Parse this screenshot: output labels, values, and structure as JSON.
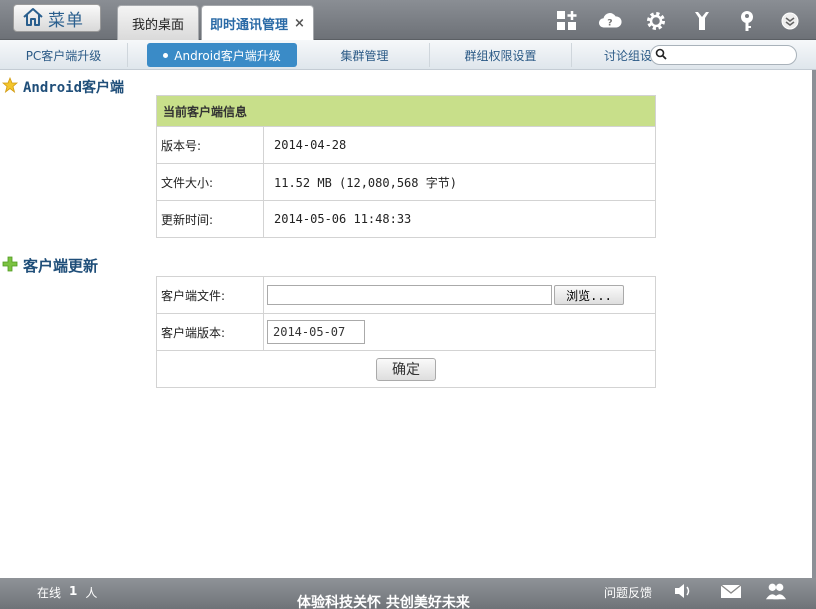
{
  "menu": {
    "label": "菜单",
    "icon": "home-icon"
  },
  "tabs": [
    {
      "label": "我的桌面"
    },
    {
      "label": "即时通讯管理",
      "close": "×"
    }
  ],
  "top_icons": [
    "add-window-icon",
    "help-cloud-icon",
    "gear-icon",
    "tools-icon",
    "key-icon",
    "chevron-down-icon"
  ],
  "subnav": {
    "items": [
      "PC客户端升级",
      "Android客户端升级",
      "集群管理",
      "群组权限设置",
      "讨论组设"
    ],
    "active_index": 1,
    "search_placeholder": ""
  },
  "android_section": {
    "title": "Android客户端",
    "table_header": "当前客户端信息",
    "rows": [
      {
        "label": "版本号:",
        "value": "2014-04-28"
      },
      {
        "label": "文件大小:",
        "value": "11.52 MB (12,080,568 字节)"
      },
      {
        "label": "更新时间:",
        "value": "2014-05-06 11:48:33"
      }
    ]
  },
  "update_section": {
    "title": "客户端更新",
    "file_label": "客户端文件:",
    "file_value": "",
    "browse_label": "浏览...",
    "version_label": "客户端版本:",
    "version_value": "2014-05-07",
    "submit_label": "确定"
  },
  "footer": {
    "online_prefix": "在线",
    "online_count": "1",
    "online_suffix": "人",
    "slogan": "体验科技关怀 共创美好未来",
    "feedback": "问题反馈",
    "icons": [
      "speaker-icon",
      "mail-icon",
      "users-icon"
    ]
  },
  "colors": {
    "accent": "#3a8bc7",
    "header_green": "#c8df8a",
    "title_blue": "#1f4e79"
  }
}
